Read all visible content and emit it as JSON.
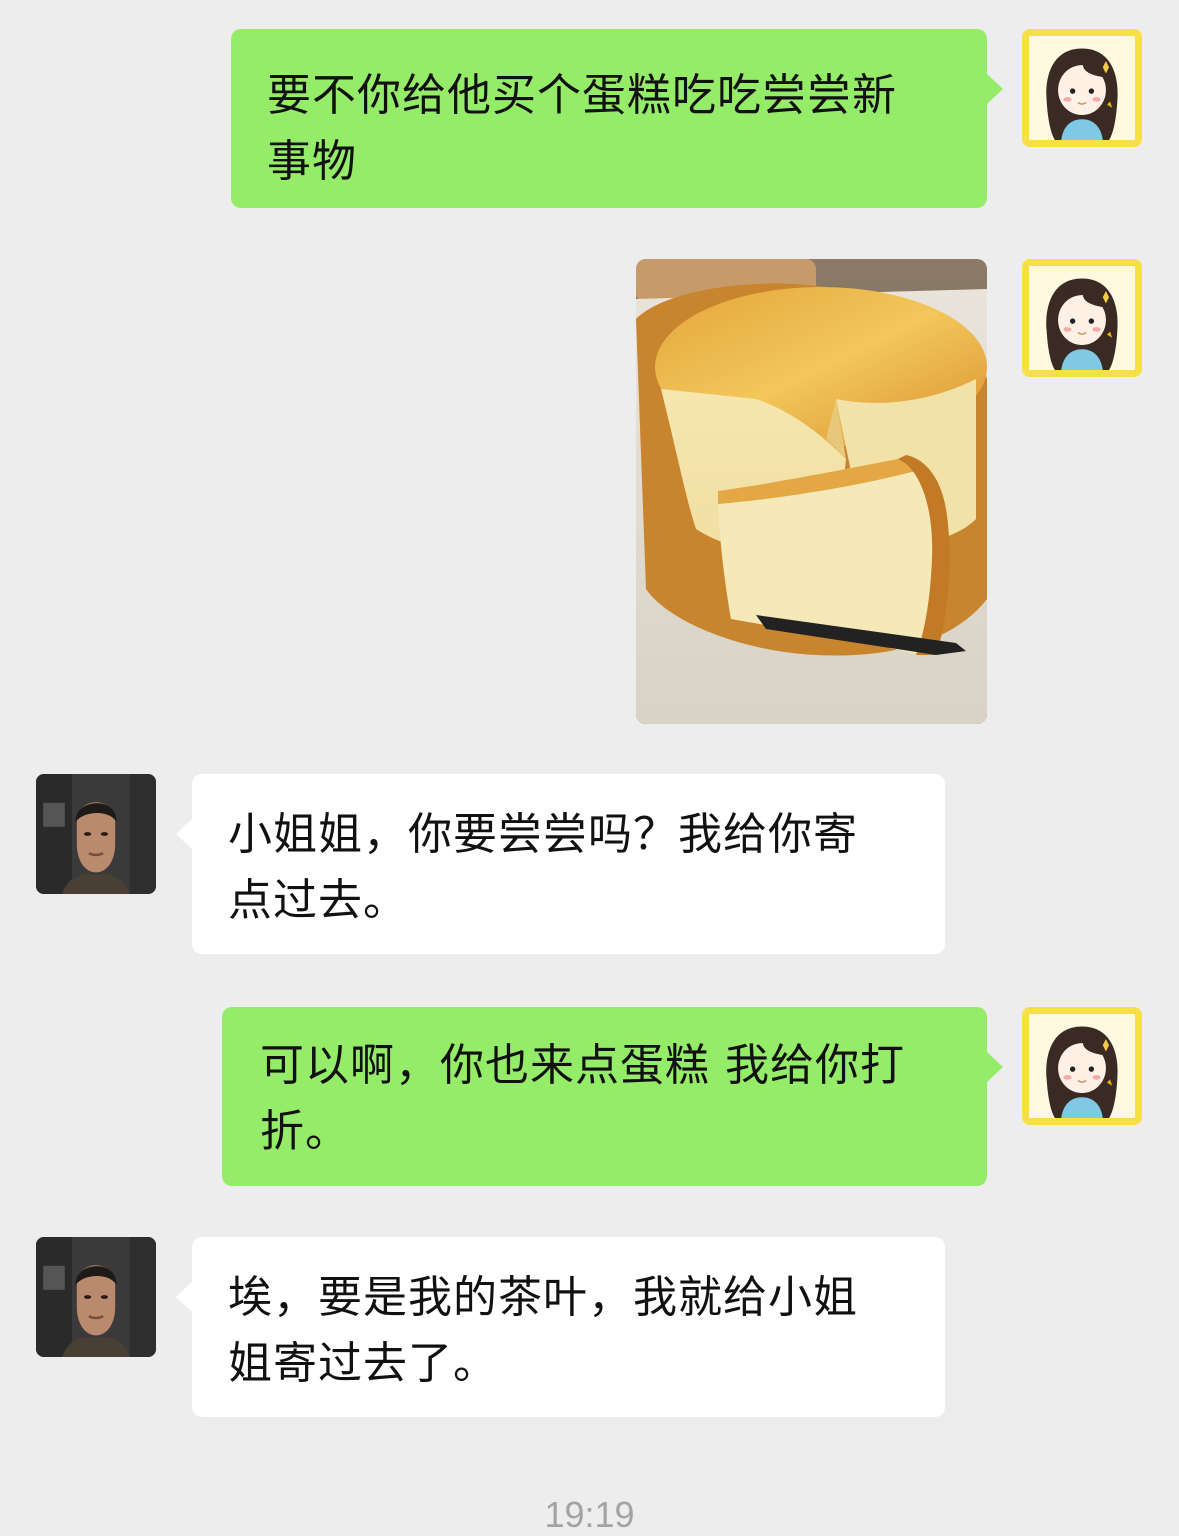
{
  "messages": [
    {
      "side": "right",
      "type": "text",
      "avatar": "girl-avatar",
      "text_lines": [
        "要不你给他买个蛋糕吃吃尝尝新",
        "事物"
      ]
    },
    {
      "side": "right",
      "type": "image",
      "avatar": "girl-avatar",
      "image": "cheesecake-photo"
    },
    {
      "side": "left",
      "type": "text",
      "avatar": "man-avatar",
      "text_lines": [
        "小姐姐，你要尝尝吗？我给你寄",
        "点过去。"
      ]
    },
    {
      "side": "right",
      "type": "text",
      "avatar": "girl-avatar",
      "text_lines": [
        "可以啊，你也来点蛋糕 我给你打",
        "折。"
      ]
    },
    {
      "side": "left",
      "type": "text",
      "avatar": "man-avatar",
      "text_lines": [
        "埃，要是我的茶叶，我就给小姐",
        "姐寄过去了。"
      ]
    }
  ],
  "timestamp": "19:19",
  "colors": {
    "background": "#ededed",
    "sent_bubble": "#95ec69",
    "received_bubble": "#ffffff",
    "avatar_frame": "#f7df47",
    "timestamp_text": "#a3a3a3"
  }
}
